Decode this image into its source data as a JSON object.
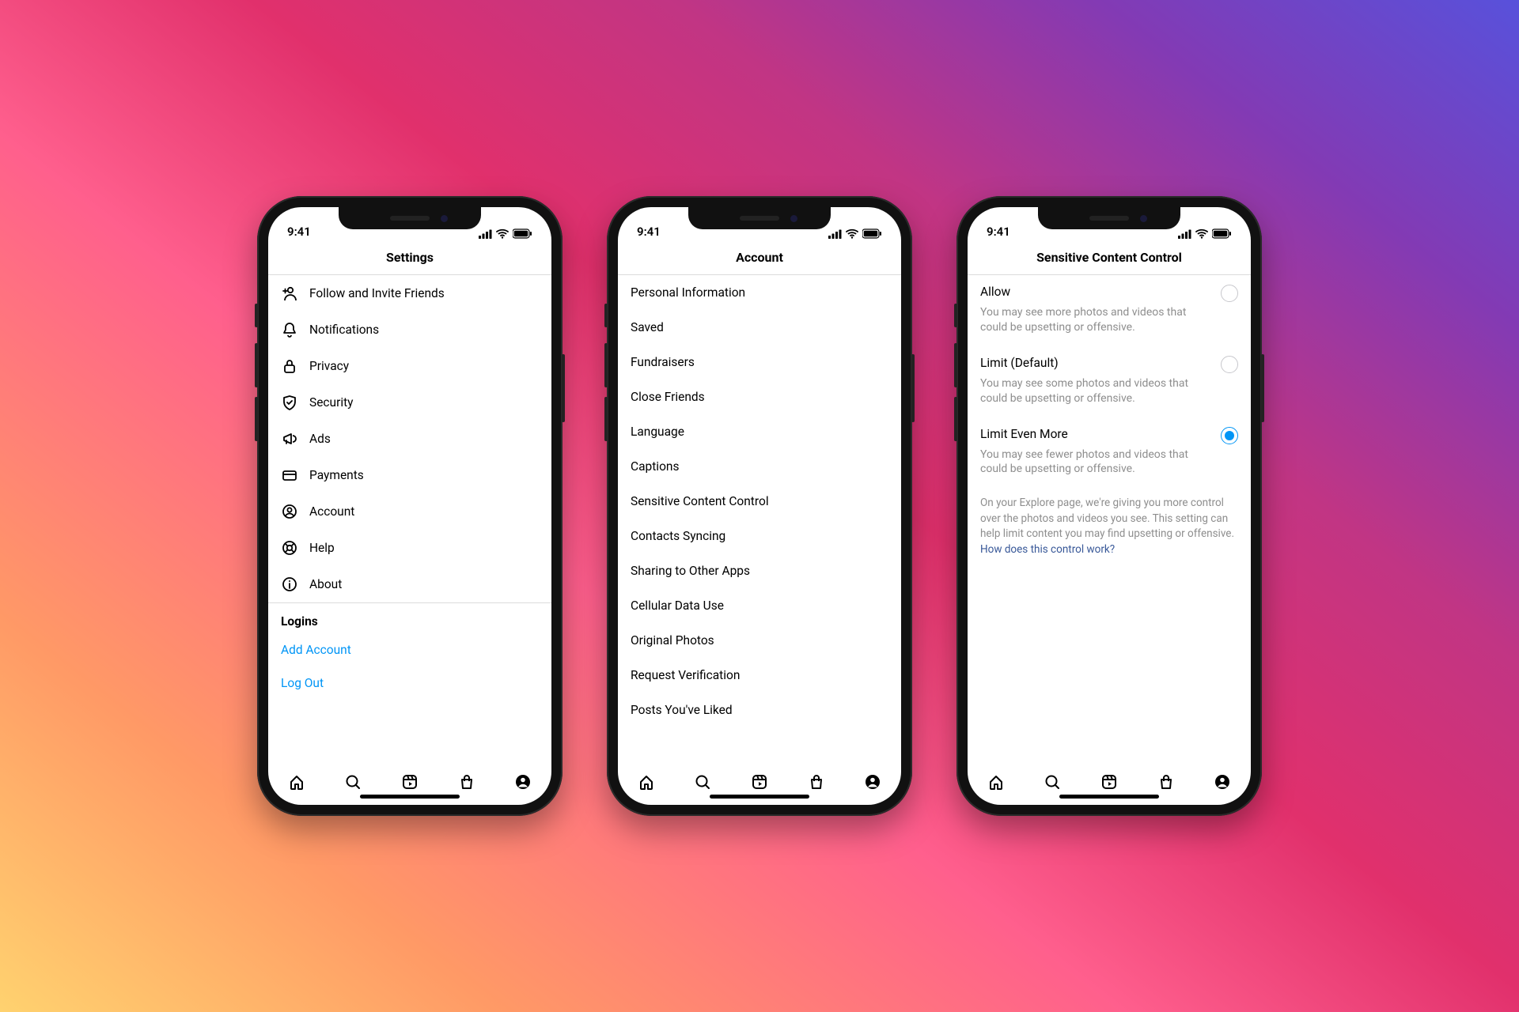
{
  "status_time": "9:41",
  "phone1": {
    "title": "Settings",
    "rows": [
      {
        "icon": "add-user",
        "label": "Follow and Invite Friends"
      },
      {
        "icon": "bell",
        "label": "Notifications"
      },
      {
        "icon": "lock",
        "label": "Privacy"
      },
      {
        "icon": "shield",
        "label": "Security"
      },
      {
        "icon": "megaphone",
        "label": "Ads"
      },
      {
        "icon": "card",
        "label": "Payments"
      },
      {
        "icon": "user-circle",
        "label": "Account"
      },
      {
        "icon": "help",
        "label": "Help"
      },
      {
        "icon": "info",
        "label": "About"
      }
    ],
    "logins_head": "Logins",
    "add_account": "Add Account",
    "log_out": "Log Out"
  },
  "phone2": {
    "title": "Account",
    "rows": [
      "Personal Information",
      "Saved",
      "Fundraisers",
      "Close Friends",
      "Language",
      "Captions",
      "Sensitive Content Control",
      "Contacts Syncing",
      "Sharing to Other Apps",
      "Cellular Data Use",
      "Original Photos",
      "Request Verification",
      "Posts You've Liked"
    ]
  },
  "phone3": {
    "title": "Sensitive Content Control",
    "options": [
      {
        "title": "Allow",
        "desc": "You may see more photos and videos that could be upsetting or offensive.",
        "checked": false
      },
      {
        "title": "Limit (Default)",
        "desc": "You may see some photos and videos that could be upsetting or offensive.",
        "checked": false
      },
      {
        "title": "Limit Even More",
        "desc": "You may see fewer photos and videos that could be upsetting or offensive.",
        "checked": true
      }
    ],
    "explain_text": "On your Explore page, we're giving you more control over the photos and videos you see. This setting can help limit content you may find upsetting or offensive. ",
    "explain_link": "How does this control work?"
  }
}
